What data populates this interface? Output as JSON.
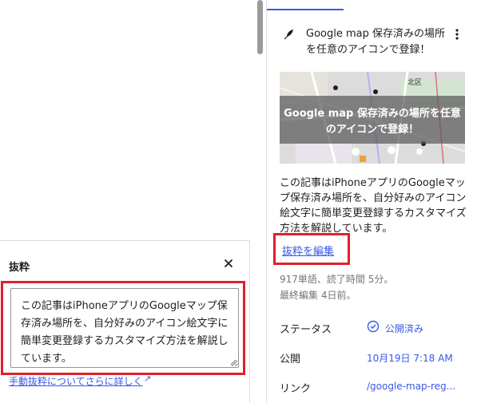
{
  "excerpt_panel": {
    "title": "抜粋",
    "text": "この記事はiPhoneアプリのGoogleマップ保存済み場所を、自分好みのアイコン絵文字に簡単変更登録するカスタマイズ方法を解説しています。",
    "learn_more_link": "手動抜粋についてさらに詳しく",
    "learn_more_suffix": "↗"
  },
  "sidebar": {
    "post_title": "Google map 保存済みの場所を任意のアイコンで登録！",
    "featured_image_caption": "Google map 保存済みの場所を任意のアイコンで登録！",
    "excerpt_preview": "この記事はiPhoneアプリのGoogleマップ保存済み場所を、自分好みのアイコン絵文字に簡単変更登録するカスタマイズ方法を解説しています。",
    "edit_excerpt_link": "抜粋を編集",
    "stats_words": "917単語、読了時間 5分。",
    "stats_edited": "最終編集 4日前。",
    "status_label": "ステータス",
    "status_value": "公開済み",
    "publish_label": "公開",
    "publish_value": "10月19日 7:18 AM",
    "link_label": "リンク",
    "link_value": "/google-map-reg..."
  },
  "map_labels": {
    "district": "北区"
  },
  "colors": {
    "accent": "#3858e9",
    "highlight": "#e0202a"
  }
}
